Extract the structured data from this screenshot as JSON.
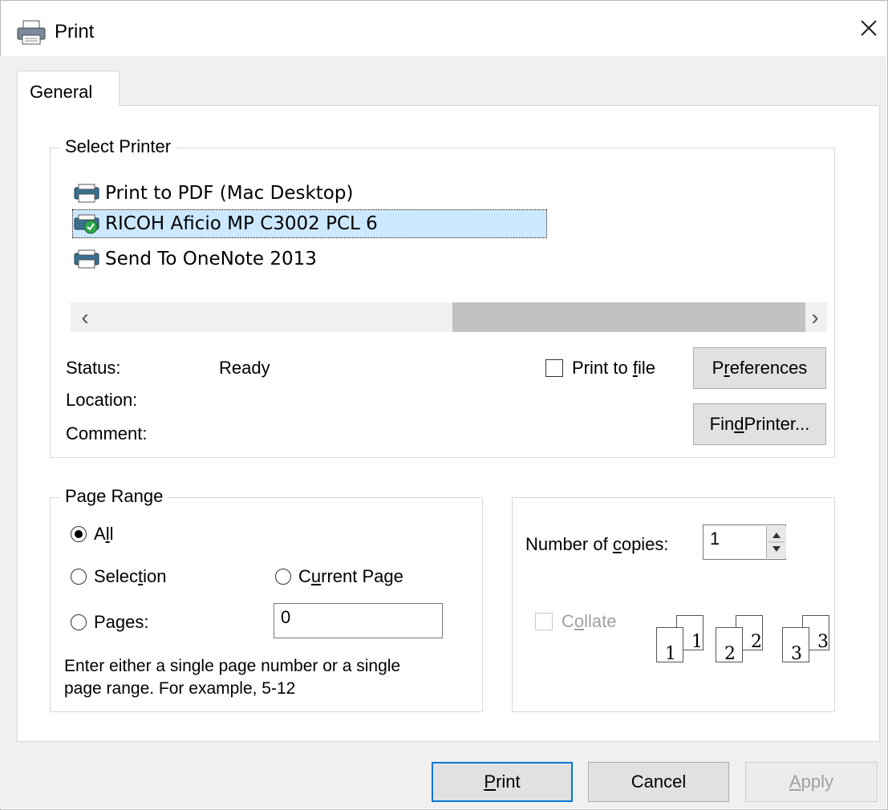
{
  "window": {
    "title": "Print",
    "close_glyph": "✕"
  },
  "tabs": [
    {
      "label": "General"
    }
  ],
  "select_printer": {
    "legend": "Select Printer",
    "printers": [
      {
        "name": "Print to PDF (Mac Desktop)",
        "selected": false,
        "icon": "printer-icon"
      },
      {
        "name": "RICOH Aficio MP C3002 PCL 6",
        "selected": true,
        "icon": "default-printer-icon"
      },
      {
        "name": "Send To OneNote 2013",
        "selected": false,
        "icon": "printer-icon"
      }
    ],
    "scroll_left": "‹",
    "scroll_right": "›",
    "status_label": "Status:",
    "status_value": "Ready",
    "location_label": "Location:",
    "location_value": "",
    "comment_label": "Comment:",
    "comment_value": "",
    "print_to_file": {
      "pre": "Print to ",
      "accel": "f",
      "post": "ile",
      "checked": false
    },
    "preferences": {
      "pre": "P",
      "accel": "r",
      "post": "eferences"
    },
    "find_printer": {
      "pre": "Fin",
      "accel": "d",
      "post": " Printer..."
    }
  },
  "page_range": {
    "legend": "Page Range",
    "all": {
      "pre": "A",
      "accel": "l",
      "post": "l",
      "checked": true
    },
    "selection": {
      "pre": "Selec",
      "accel": "t",
      "post": "ion",
      "checked": false
    },
    "current_page": {
      "pre": "C",
      "accel": "u",
      "post": "rrent Page",
      "checked": false
    },
    "pages": {
      "pre": "Pa",
      "accel": "g",
      "post": "es:",
      "checked": false
    },
    "pages_value": "0",
    "hint_line1": "Enter either a single page number or a single",
    "hint_line2": "page range.  For example, 5-12"
  },
  "copies": {
    "label_pre": "Number of ",
    "label_accel": "c",
    "label_post": "opies:",
    "value": "1",
    "collate": {
      "pre": "C",
      "accel": "o",
      "post": "llate",
      "checked": false,
      "enabled": false
    },
    "sheets": [
      "1",
      "1",
      "2",
      "2",
      "3",
      "3"
    ]
  },
  "buttons": {
    "print": {
      "accel": "P",
      "post": "rint"
    },
    "cancel": "Cancel",
    "apply": {
      "accel": "A",
      "post": "pply"
    }
  },
  "colors": {
    "accent": "#0078d7",
    "selection_bg": "#cce8ff",
    "dialog_bg": "#f0f0f0"
  }
}
